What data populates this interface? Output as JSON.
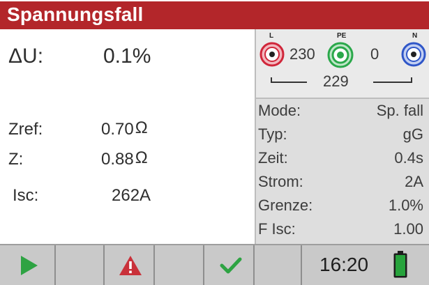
{
  "header": {
    "title": "Spannungsfall"
  },
  "results": {
    "delta_u": {
      "label": "ΔU:",
      "value": "0.1%"
    },
    "zref": {
      "label": "Zref:",
      "value": "0.70",
      "unit": "Ω"
    },
    "z": {
      "label": "Z:",
      "value": "0.88",
      "unit": "Ω"
    },
    "isc": {
      "label": "Isc:",
      "value": "262A"
    }
  },
  "terminals": {
    "l": {
      "label": "L",
      "color": "#d0263a"
    },
    "pe": {
      "label": "PE",
      "color": "#2aa84a"
    },
    "n": {
      "label": "N",
      "color": "#2f56c8"
    },
    "v_l_pe": "230",
    "v_pe_n": "0",
    "v_l_n": "229"
  },
  "settings": [
    {
      "key": "Mode:",
      "value": "Sp. fall"
    },
    {
      "key": "Typ:",
      "value": "gG"
    },
    {
      "key": "Zeit:",
      "value": "0.4s"
    },
    {
      "key": "Strom:",
      "value": "2A"
    },
    {
      "key": "Grenze:",
      "value": "1.0%"
    },
    {
      "key": "F Isc:",
      "value": "1.00"
    }
  ],
  "footer": {
    "softkeys": [
      "play-icon",
      "",
      "warning-icon",
      "",
      "checkmark-icon",
      ""
    ],
    "time": "16:20",
    "battery_level": 1.0,
    "colors": {
      "play": "#2ea343",
      "warning": "#c9313a",
      "check": "#2ea343",
      "battery": "#27a33c"
    }
  }
}
